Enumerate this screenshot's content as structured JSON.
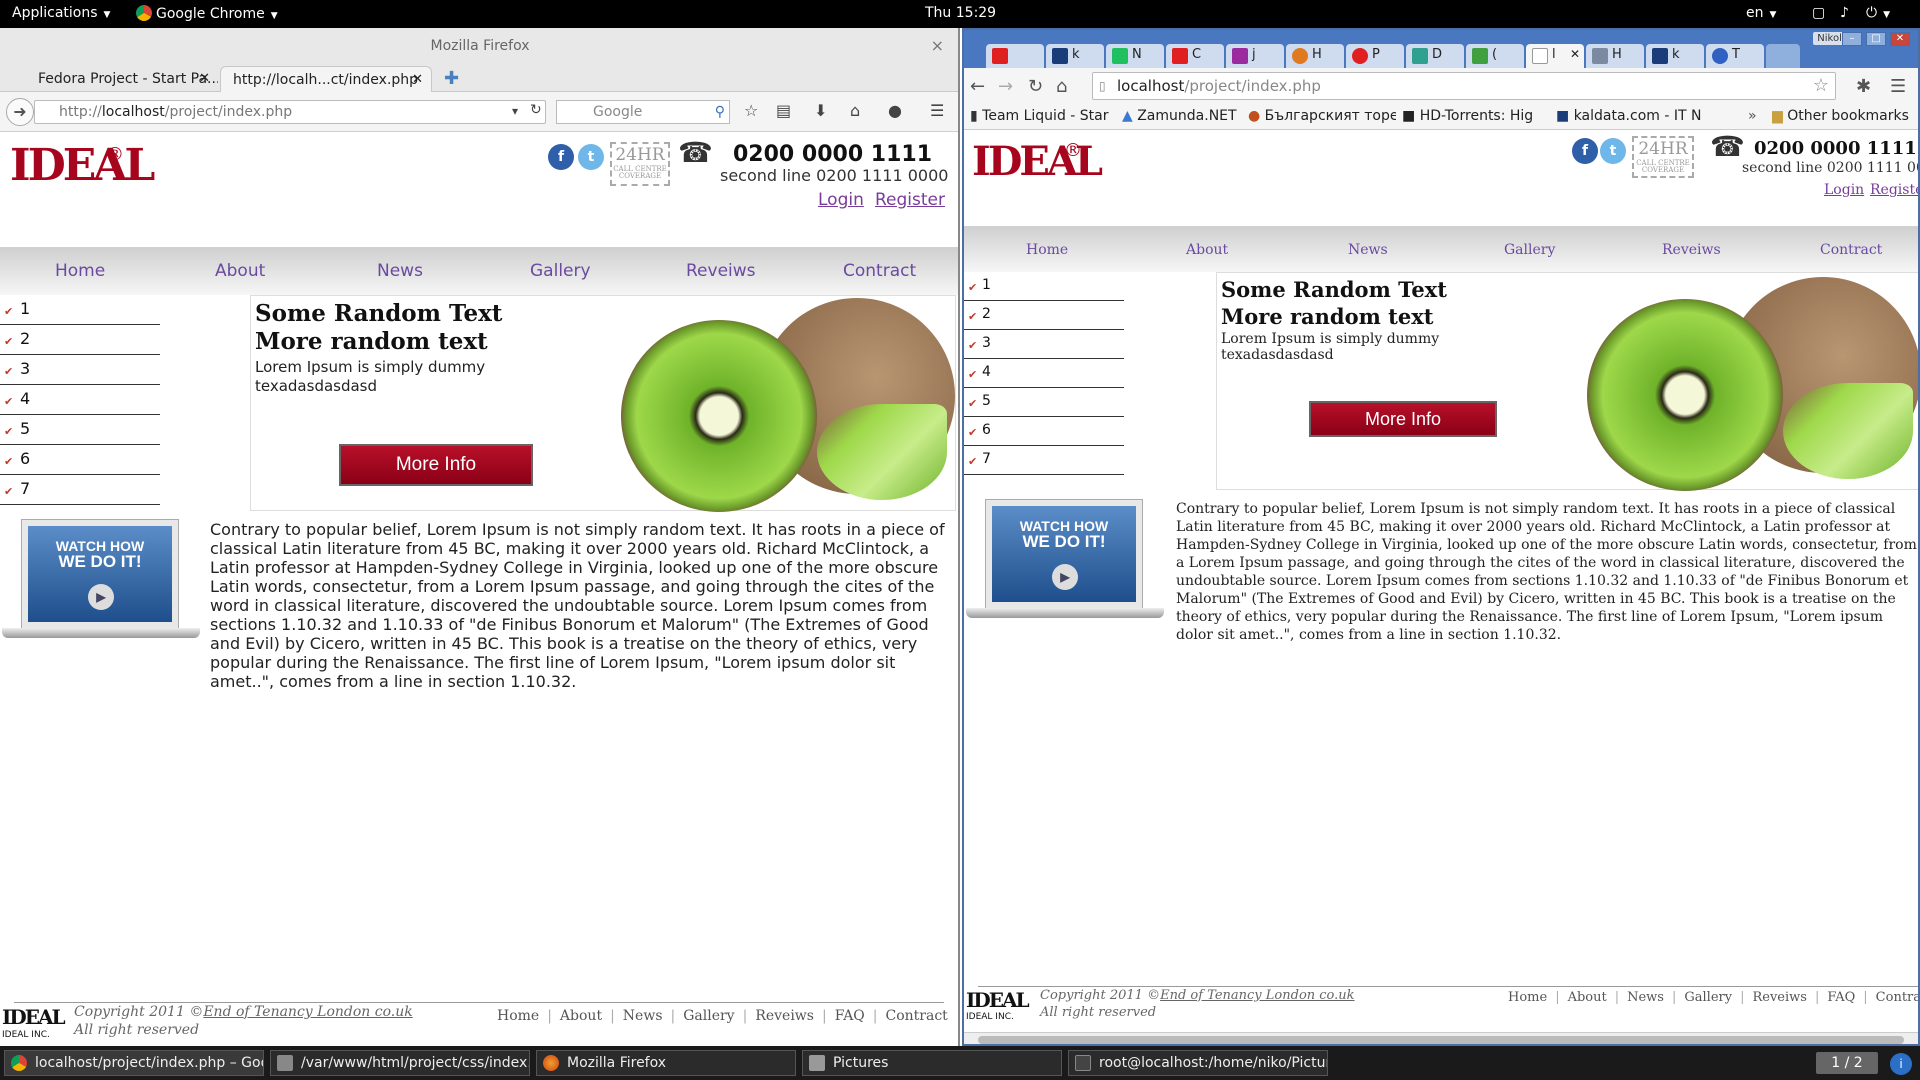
{
  "top_panel": {
    "applications": "Applications",
    "active_app": "Google Chrome",
    "clock": "Thu 15:29",
    "lang": "en"
  },
  "firefox": {
    "window_title": "Mozilla Firefox",
    "tabs": [
      {
        "label": "Fedora Project - Start Pa..."
      },
      {
        "label": "http://localh...ct/index.php"
      }
    ],
    "url_prefix": "http://",
    "url_host": "localhost",
    "url_path": "/project/index.php",
    "search_placeholder": "Google"
  },
  "chrome": {
    "tabs": [
      {
        "label": "",
        "color": "#e02020"
      },
      {
        "label": "k",
        "color": "#1a3d7a"
      },
      {
        "label": "k",
        "color": "#1a3d7a"
      },
      {
        "label": "N",
        "color": "#20c060"
      },
      {
        "label": "C",
        "color": "#e02020"
      },
      {
        "label": "j",
        "color": "#9b2ca0"
      },
      {
        "label": "H",
        "color": "#e07a20"
      },
      {
        "label": "P",
        "color": "#e02020"
      },
      {
        "label": "D",
        "color": "#30a090"
      },
      {
        "label": "(",
        "color": "#40a040"
      },
      {
        "label": "l",
        "color": "#ffffff"
      },
      {
        "label": "H",
        "color": "#7b8aa0"
      },
      {
        "label": "k",
        "color": "#1a3d7a"
      },
      {
        "label": "T",
        "color": "#3060c0"
      }
    ],
    "profile": "Nikola",
    "url_host": "localhost",
    "url_path": "/project/index.php",
    "bookmarks": [
      {
        "label": "Team Liquid - Star"
      },
      {
        "label": "Zamunda.NET"
      },
      {
        "label": "Българският торе"
      },
      {
        "label": "HD-Torrents: Hig"
      },
      {
        "label": "kaldata.com - IT N"
      }
    ],
    "other_bookmarks": "Other bookmarks"
  },
  "site": {
    "logo": "IDEAL",
    "phone_main": "0200 0000 1111",
    "phone_second": "second line 0200 1111 0000",
    "badge_24hr": "24HR",
    "badge_sub": "CALL CENTRE COVERAGE",
    "login": "Login",
    "register": "Register",
    "nav": [
      "Home",
      "About",
      "News",
      "Gallery",
      "Reveiws",
      "Contract"
    ],
    "side_items": [
      "1",
      "2",
      "3",
      "4",
      "5",
      "6",
      "7"
    ],
    "promo_title1": "Some Random Text",
    "promo_title2": "More random text",
    "promo_text": "Lorem Ipsum is simply dummy texadasdasdasd",
    "more_info": "More Info",
    "watch_line1": "WATCH HOW",
    "watch_line2": "WE DO IT!",
    "body": "Contrary to popular belief, Lorem Ipsum is not simply random text. It has roots in a piece of classical Latin literature from 45 BC, making it over 2000 years old. Richard McClintock, a Latin professor at Hampden-Sydney College in Virginia, looked up one of the more obscure Latin words, consectetur, from a Lorem Ipsum passage, and going through the cites of the word in classical literature, discovered the undoubtable source. Lorem Ipsum comes from sections 1.10.32 and 1.10.33 of \"de Finibus Bonorum et Malorum\" (The Extremes of Good and Evil) by Cicero, written in 45 BC. This book is a treatise on the theory of ethics, very popular during the Renaissance. The first line of Lorem Ipsum, \"Lorem ipsum dolor sit amet..\", comes from a line in section 1.10.32.",
    "footer_logo": "IDEAL",
    "footer_inc": "IDEAL INC.",
    "footer_copy_prefix": "Copyright 2011 ©",
    "footer_copy_link": "End of Tenancy London co.uk",
    "footer_rights": "All right reserved",
    "footer_links": [
      "Home",
      "About",
      "News",
      "Gallery",
      "Reveiws",
      "FAQ",
      "Contract"
    ]
  },
  "taskbar": {
    "items": [
      {
        "label": "localhost/project/index.php – Goo...",
        "color": "#e0a020"
      },
      {
        "label": "/var/www/html/project/css/index....",
        "color": "#888888"
      },
      {
        "label": "Mozilla Firefox",
        "color": "#e06020"
      },
      {
        "label": "Pictures",
        "color": "#999999"
      },
      {
        "label": "root@localhost:/home/niko/Pictures",
        "color": "#444444"
      }
    ],
    "workspace": "1 / 2"
  }
}
